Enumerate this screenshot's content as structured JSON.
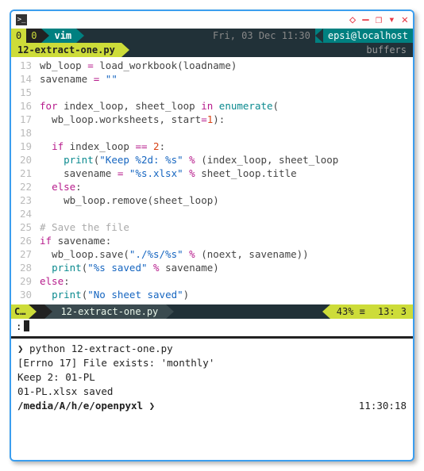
{
  "titlebar": {
    "icon_glyph": ">_",
    "pin": "◇",
    "min": "—",
    "restore": "❐",
    "alt": "▾",
    "close": "✕"
  },
  "status1": {
    "left_a": "0",
    "left_b": "0",
    "mode": "vim",
    "datetime": "Fri, 03 Dec 11:30",
    "user": "epsi@localhost"
  },
  "tabs": {
    "active": "12-extract-one.py",
    "right": "buffers"
  },
  "code": {
    "lines": [
      {
        "n": "13",
        "html": "wb_loop <span class='op'>=</span> load_workbook(loadname)"
      },
      {
        "n": "14",
        "html": "savename <span class='op'>=</span> <span class='str'>\"\"</span>"
      },
      {
        "n": "15",
        "html": ""
      },
      {
        "n": "16",
        "html": "<span class='kw'>for</span> index_loop, sheet_loop <span class='kw'>in</span> <span class='fn'>enumerate</span>("
      },
      {
        "n": "17",
        "html": "  wb_loop.worksheets, start<span class='op'>=</span><span class='num'>1</span>):"
      },
      {
        "n": "18",
        "html": ""
      },
      {
        "n": "19",
        "html": "  <span class='kw'>if</span> index_loop <span class='op'>==</span> <span class='num'>2</span>:"
      },
      {
        "n": "20",
        "html": "    <span class='fn'>print</span>(<span class='str'>\"Keep %2d: %s\"</span> <span class='op'>%</span> (index_loop, sheet_loop"
      },
      {
        "n": "21",
        "html": "    savename <span class='op'>=</span> <span class='str'>\"%s.xlsx\"</span> <span class='op'>%</span> sheet_loop.title"
      },
      {
        "n": "22",
        "html": "  <span class='kw'>else</span>:"
      },
      {
        "n": "23",
        "html": "    wb_loop.remove(sheet_loop)"
      },
      {
        "n": "24",
        "html": ""
      },
      {
        "n": "25",
        "html": "<span class='cm'># Save the file</span>"
      },
      {
        "n": "26",
        "html": "<span class='kw'>if</span> savename:"
      },
      {
        "n": "27",
        "html": "  wb_loop.save(<span class='str'>\"./%s/%s\"</span> <span class='op'>%</span> (noext, savename))"
      },
      {
        "n": "28",
        "html": "  <span class='fn'>print</span>(<span class='str'>\"%s saved\"</span> <span class='op'>%</span> savename)"
      },
      {
        "n": "29",
        "html": "<span class='kw'>else</span>:"
      },
      {
        "n": "30",
        "html": "  <span class='fn'>print</span>(<span class='str'>\"No sheet saved\"</span>)"
      }
    ]
  },
  "status2": {
    "mode": "C…",
    "file": "12-extract-one.py",
    "pct": "43% ≡",
    "pos": "13:  3"
  },
  "cmdline": {
    "prefix": ":"
  },
  "terminal": {
    "l1": "❯ python 12-extract-one.py",
    "l2": "[Errno 17] File exists: 'monthly'",
    "l3": "Keep  2: 01-PL",
    "l4": "01-PL.xlsx saved",
    "prompt_path": "/media/A/h/e/",
    "prompt_cwd": "openpyxl",
    "prompt_glyph": "❯",
    "time": "11:30:18"
  }
}
